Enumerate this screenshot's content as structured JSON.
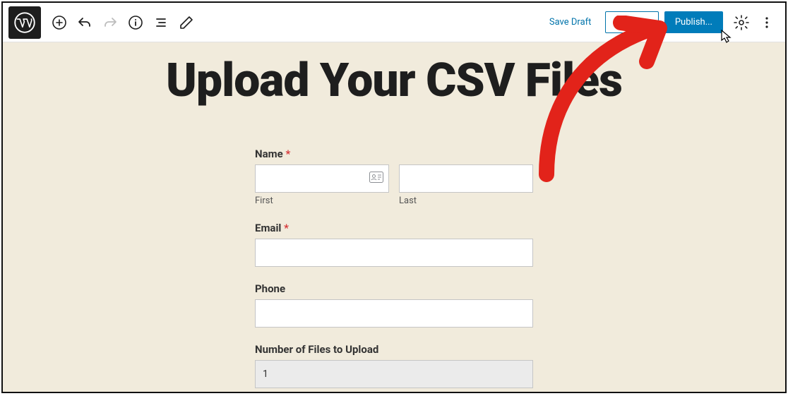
{
  "toolbar": {
    "save_draft": "Save Draft",
    "preview": "Preview",
    "publish": "Publish..."
  },
  "page": {
    "title": "Upload Your CSV Files"
  },
  "form": {
    "name": {
      "label": "Name",
      "required": "*",
      "first_sub": "First",
      "last_sub": "Last"
    },
    "email": {
      "label": "Email",
      "required": "*"
    },
    "phone": {
      "label": "Phone"
    },
    "numfiles": {
      "label": "Number of Files to Upload",
      "value": "1"
    }
  }
}
